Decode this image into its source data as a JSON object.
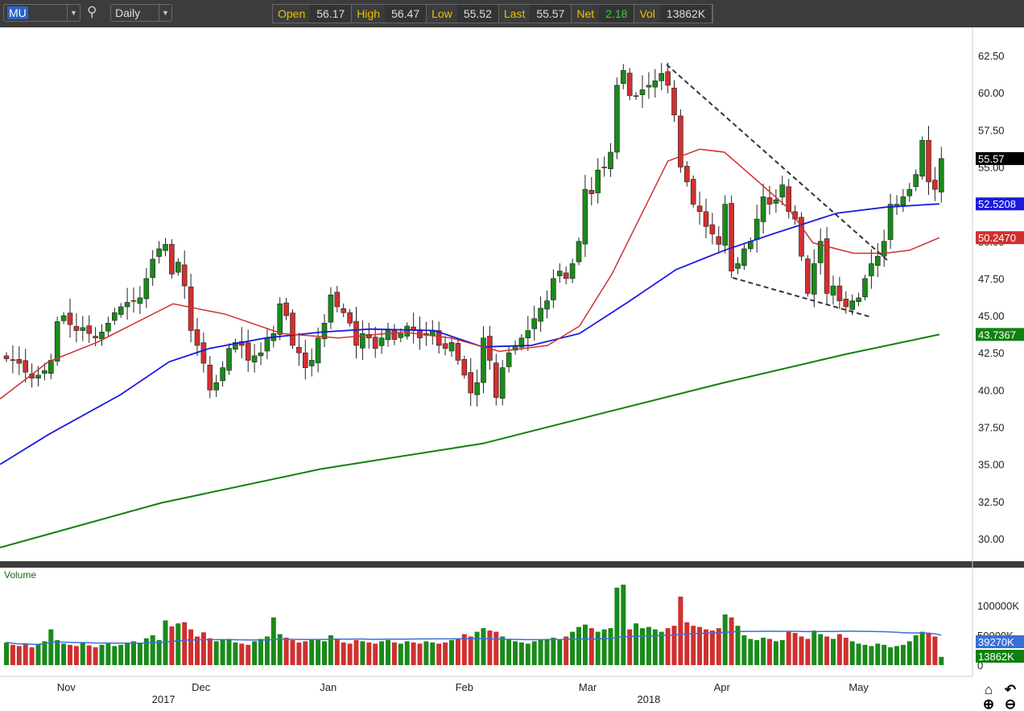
{
  "toolbar": {
    "symbol": "MU",
    "interval": "Daily",
    "quote": [
      {
        "label": "Open",
        "value": "56.17"
      },
      {
        "label": "High",
        "value": "56.47"
      },
      {
        "label": "Low",
        "value": "55.52"
      },
      {
        "label": "Last",
        "value": "55.57"
      },
      {
        "label": "Net",
        "value": "2.18"
      },
      {
        "label": "Vol",
        "value": "13862K"
      }
    ]
  },
  "colors": {
    "up": "#1a8a1a",
    "down": "#d03030",
    "ma20": "#d03030",
    "ma50": "#1a1ae0",
    "ma200": "#108010",
    "volma": "#3a6fd8",
    "net": "#3ccc3c"
  },
  "chart_data": {
    "type": "candlestick",
    "symbol": "MU",
    "interval": "Daily",
    "ylim": [
      28.5,
      64
    ],
    "yticks": [
      "30.00",
      "32.50",
      "35.00",
      "37.50",
      "40.00",
      "42.50",
      "45.00",
      "47.50",
      "50.00",
      "52.50",
      "55.00",
      "57.50",
      "60.00",
      "62.50"
    ],
    "x_labels": [
      {
        "day": 9.4,
        "label": "Nov"
      },
      {
        "day": 30.6,
        "label": "Dec"
      },
      {
        "day": 50.6,
        "label": "Jan"
      },
      {
        "day": 72,
        "label": "Feb"
      },
      {
        "day": 91.4,
        "label": "Mar"
      },
      {
        "day": 112.5,
        "label": "Apr"
      },
      {
        "day": 134,
        "label": "May"
      }
    ],
    "year_labels": [
      {
        "day": 24.7,
        "label": "2017"
      },
      {
        "day": 101,
        "label": "2018"
      }
    ],
    "closes": [
      42.1,
      42.0,
      41.8,
      41.2,
      40.8,
      41.0,
      41.3,
      42.0,
      44.6,
      45.0,
      44.4,
      44.0,
      44.2,
      43.8,
      43.5,
      43.9,
      44.5,
      45.2,
      45.6,
      45.9,
      46.0,
      46.2,
      47.5,
      48.8,
      49.5,
      49.8,
      47.8,
      48.6,
      47.0,
      44.0,
      43.0,
      41.8,
      40.0,
      40.5,
      41.5,
      42.8,
      43.2,
      43.0,
      42.0,
      42.3,
      42.5,
      43.5,
      43.8,
      45.8,
      45.0,
      43.0,
      42.5,
      41.5,
      42.0,
      43.5,
      44.5,
      46.4,
      45.6,
      45.2,
      44.5,
      43.0,
      43.8,
      43.5,
      42.8,
      43.5,
      44.0,
      43.4,
      43.8,
      44.3,
      44.0,
      43.5,
      43.8,
      44.0,
      43.0,
      42.8,
      43.2,
      42.0,
      41.0,
      39.8,
      40.5,
      43.5,
      42.0,
      39.5,
      41.5,
      42.5,
      43.0,
      43.5,
      44.0,
      44.8,
      45.5,
      46.0,
      47.5,
      48.0,
      47.5,
      48.5,
      50.0,
      53.5,
      53.2,
      54.8,
      55.0,
      56.0,
      60.5,
      61.5,
      59.8,
      59.8,
      60.2,
      60.5,
      60.8,
      61.3,
      60.5,
      58.5,
      55.0,
      54.0,
      52.5,
      52.0,
      51.0,
      50.5,
      49.8,
      52.5,
      48.0,
      48.5,
      49.5,
      50.0,
      51.5,
      53.0,
      52.5,
      52.8,
      53.8,
      52.0,
      51.5,
      49.0,
      46.5,
      48.5,
      50.0,
      46.5,
      47.0,
      46.0,
      45.6,
      46.0,
      46.2,
      47.5,
      48.5,
      49.0,
      50.0,
      52.5,
      52.5,
      53.0,
      53.5,
      54.5,
      56.8,
      54.0,
      53.5,
      55.57
    ],
    "volumes_k": [
      38000,
      34000,
      32000,
      36000,
      30000,
      35000,
      40000,
      60000,
      42000,
      36000,
      34000,
      32000,
      38000,
      33000,
      30000,
      34000,
      36000,
      32000,
      34000,
      38000,
      40000,
      36000,
      45000,
      50000,
      42000,
      75000,
      65000,
      70000,
      72000,
      60000,
      48000,
      55000,
      45000,
      40000,
      42000,
      44000,
      38000,
      36000,
      34000,
      40000,
      44000,
      48000,
      80000,
      52000,
      46000,
      42000,
      38000,
      40000,
      44000,
      42000,
      40000,
      50000,
      44000,
      38000,
      36000,
      42000,
      40000,
      38000,
      36000,
      40000,
      42000,
      38000,
      36000,
      40000,
      38000,
      36000,
      40000,
      38000,
      36000,
      38000,
      42000,
      44000,
      52000,
      48000,
      56000,
      62000,
      58000,
      56000,
      48000,
      44000,
      40000,
      38000,
      36000,
      40000,
      42000,
      44000,
      46000,
      42000,
      48000,
      56000,
      64000,
      68000,
      62000,
      56000,
      60000,
      62000,
      130000,
      135000,
      60000,
      70000,
      62000,
      64000,
      60000,
      56000,
      62000,
      66000,
      115000,
      72000,
      66000,
      64000,
      60000,
      58000,
      62000,
      85000,
      80000,
      66000,
      50000,
      44000,
      42000,
      46000,
      44000,
      40000,
      42000,
      56000,
      54000,
      48000,
      44000,
      58000,
      52000,
      48000,
      44000,
      52000,
      46000,
      40000,
      36000,
      34000,
      32000,
      36000,
      34000,
      30000,
      32000,
      34000,
      40000,
      50000,
      56000,
      54000,
      48000,
      13862
    ],
    "ma20_knots": [
      [
        -1,
        39.4
      ],
      [
        6.6,
        41.9
      ],
      [
        14.2,
        43.2
      ],
      [
        26.2,
        45.8
      ],
      [
        34.4,
        45.1
      ],
      [
        43.3,
        43.8
      ],
      [
        52.2,
        43.5
      ],
      [
        62.3,
        43.9
      ],
      [
        69.9,
        43.5
      ],
      [
        77.5,
        42.6
      ],
      [
        85.1,
        43.0
      ],
      [
        90.1,
        44.3
      ],
      [
        95.2,
        47.8
      ],
      [
        100.3,
        52.2
      ],
      [
        104,
        55.4
      ],
      [
        109,
        56.2
      ],
      [
        112.9,
        56.0
      ],
      [
        118,
        54.1
      ],
      [
        123,
        52.2
      ],
      [
        126.8,
        49.9
      ],
      [
        133.2,
        49.2
      ],
      [
        138.2,
        49.2
      ],
      [
        142,
        49.4
      ],
      [
        146.7,
        50.247
      ]
    ],
    "ma50_knots": [
      [
        -1,
        35.0
      ],
      [
        6.6,
        37.0
      ],
      [
        18,
        39.7
      ],
      [
        25.6,
        41.9
      ],
      [
        31.9,
        42.8
      ],
      [
        40.8,
        43.5
      ],
      [
        49.6,
        43.9
      ],
      [
        57.2,
        44.1
      ],
      [
        67.3,
        44.0
      ],
      [
        74.9,
        42.9
      ],
      [
        82.5,
        43.0
      ],
      [
        90.1,
        43.8
      ],
      [
        97.7,
        45.9
      ],
      [
        105.3,
        48.1
      ],
      [
        112.9,
        49.4
      ],
      [
        120.5,
        50.5
      ],
      [
        130.6,
        51.9
      ],
      [
        138.2,
        52.3
      ],
      [
        146.7,
        52.5208
      ]
    ],
    "ma200_knots": [
      [
        -1,
        29.4
      ],
      [
        24.3,
        32.4
      ],
      [
        49.6,
        34.7
      ],
      [
        74.9,
        36.4
      ],
      [
        95.2,
        38.6
      ],
      [
        112.9,
        40.5
      ],
      [
        131.9,
        42.4
      ],
      [
        146.7,
        43.7367
      ]
    ],
    "trendlines": [
      {
        "from": [
          103.8,
          61.9
        ],
        "to": [
          138.6,
          48.7
        ]
      },
      {
        "from": [
          114.2,
          47.55
        ],
        "to": [
          136,
          44.9
        ]
      }
    ],
    "price_badges": [
      {
        "label": "55.57",
        "color": "#000000",
        "value": 55.57
      },
      {
        "label": "52.5208",
        "color": "#1a1ae0",
        "value": 52.5208
      },
      {
        "label": "50.2470",
        "color": "#d03030",
        "value": 50.247
      },
      {
        "label": "43.7367",
        "color": "#108010",
        "value": 43.7367
      }
    ],
    "volume": {
      "title": "Volume",
      "ticks": [
        {
          "v": 100000,
          "label": "100000K"
        },
        {
          "v": 50000,
          "label": "50000K"
        },
        {
          "v": 0,
          "label": "0"
        }
      ],
      "badges": [
        {
          "label": "39270K",
          "color": "#3a6fd8",
          "value": 39270
        },
        {
          "label": "13862K",
          "color": "#108010",
          "value": 13862
        }
      ]
    }
  }
}
